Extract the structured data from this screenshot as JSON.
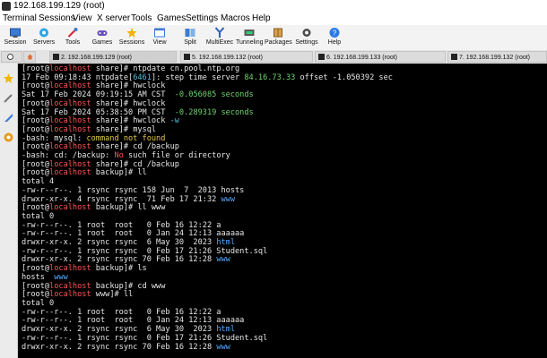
{
  "window": {
    "title": "192.168.199.129 (root)"
  },
  "menu": [
    "Terminal",
    "Sessions",
    "View",
    "X server",
    "Tools",
    "Games",
    "Settings",
    "Macros",
    "Help"
  ],
  "toolbar": [
    {
      "label": "Session",
      "icon": "session-icon"
    },
    {
      "label": "Servers",
      "icon": "servers-icon"
    },
    {
      "label": "Tools",
      "icon": "tools-icon"
    },
    {
      "label": "Games",
      "icon": "games-icon"
    },
    {
      "label": "Sessions",
      "icon": "sessions-icon"
    },
    {
      "label": "View",
      "icon": "view-icon"
    },
    {
      "label": "Split",
      "icon": "split-icon"
    },
    {
      "label": "MultiExec",
      "icon": "multiexec-icon"
    },
    {
      "label": "Tunneling",
      "icon": "tunneling-icon"
    },
    {
      "label": "Packages",
      "icon": "packages-icon"
    },
    {
      "label": "Settings",
      "icon": "settings-icon"
    },
    {
      "label": "Help",
      "icon": "help-icon"
    }
  ],
  "tabs": [
    {
      "label": "2. 192.168.199.129 (root)",
      "active": true
    },
    {
      "label": "5. 192.168.199.132 (root)",
      "active": false
    },
    {
      "label": "6. 192.168.199.133 (root)",
      "active": false
    },
    {
      "label": "7. 192.168.199.132 (root)",
      "active": false
    }
  ],
  "colors": {
    "red": "#ff5555",
    "cyan": "#55b9d8",
    "green": "#6fd36f",
    "yellow": "#e3c84a",
    "blue": "#55aaff"
  },
  "terminal": {
    "lines": [
      [
        {
          "t": "[root@"
        },
        {
          "t": "localhost",
          "c": "red"
        },
        {
          "t": " share]# ntpdate cn.pool.ntp.org"
        }
      ],
      [
        {
          "t": "17 Feb 09:18:43 ntpdate["
        },
        {
          "t": "6461",
          "c": "cy"
        },
        {
          "t": "]: step time server "
        },
        {
          "t": "84.16.73.33",
          "c": "gr"
        },
        {
          "t": " offset -1.050392 sec"
        }
      ],
      [
        {
          "t": "[root@"
        },
        {
          "t": "localhost",
          "c": "red"
        },
        {
          "t": " share]# hwclock"
        }
      ],
      [
        {
          "t": "Sat 17 Feb 2024 09:19:15 AM CST  "
        },
        {
          "t": "-0.056085 seconds",
          "c": "gr"
        }
      ],
      [
        {
          "t": "[root@"
        },
        {
          "t": "localhost",
          "c": "red"
        },
        {
          "t": " share]# hwclock"
        }
      ],
      [
        {
          "t": "Sat 17 Feb 2024 05:38:50 PM CST  "
        },
        {
          "t": "-0.289319 seconds",
          "c": "gr"
        }
      ],
      [
        {
          "t": "[root@"
        },
        {
          "t": "localhost",
          "c": "red"
        },
        {
          "t": " share]# hwclock "
        },
        {
          "t": "-w",
          "c": "cy"
        }
      ],
      [
        {
          "t": "[root@"
        },
        {
          "t": "localhost",
          "c": "red"
        },
        {
          "t": " share]# mysql"
        }
      ],
      [
        {
          "t": "-bash: mysql: "
        },
        {
          "t": "command not found",
          "c": "ye"
        }
      ],
      [
        {
          "t": "[root@"
        },
        {
          "t": "localhost",
          "c": "red"
        },
        {
          "t": " share]# cd /backup"
        }
      ],
      [
        {
          "t": "-bash: cd: /backup: "
        },
        {
          "t": "No",
          "c": "red"
        },
        {
          "t": " such file or directory"
        }
      ],
      [
        {
          "t": "[root@"
        },
        {
          "t": "localhost",
          "c": "red"
        },
        {
          "t": " share]# cd /backup"
        }
      ],
      [
        {
          "t": "[root@"
        },
        {
          "t": "localhost",
          "c": "red"
        },
        {
          "t": " backup]# ll"
        }
      ],
      [
        {
          "t": "total 4"
        }
      ],
      [
        {
          "t": "-rw-r--r--. 1 rsync rsync 158 Jun  7  2013 hosts"
        }
      ],
      [
        {
          "t": "drwxr-xr-x. 4 rsync rsync  71 Feb 17 21:32 "
        },
        {
          "t": "www",
          "c": "bl"
        }
      ],
      [
        {
          "t": "[root@"
        },
        {
          "t": "localhost",
          "c": "red"
        },
        {
          "t": " backup]# ll www"
        }
      ],
      [
        {
          "t": "total 0"
        }
      ],
      [
        {
          "t": "-rw-r--r--. 1 root  root   0 Feb 16 12:22 a"
        }
      ],
      [
        {
          "t": "-rw-r--r--. 1 root  root   0 Jan 24 12:13 aaaaaa"
        }
      ],
      [
        {
          "t": "drwxr-xr-x. 2 rsync rsync  6 May 30  2023 "
        },
        {
          "t": "html",
          "c": "bl"
        }
      ],
      [
        {
          "t": "-rw-r--r--. 1 rsync rsync  0 Feb 17 21:26 Student.sql"
        }
      ],
      [
        {
          "t": "drwxr-xr-x. 2 rsync rsync 70 Feb 16 12:28 "
        },
        {
          "t": "www",
          "c": "bl"
        }
      ],
      [
        {
          "t": "[root@"
        },
        {
          "t": "localhost",
          "c": "red"
        },
        {
          "t": " backup]# ls"
        }
      ],
      [
        {
          "t": "hosts  "
        },
        {
          "t": "www",
          "c": "bl"
        }
      ],
      [
        {
          "t": "[root@"
        },
        {
          "t": "localhost",
          "c": "red"
        },
        {
          "t": " backup]# cd www"
        }
      ],
      [
        {
          "t": "[root@"
        },
        {
          "t": "localhost",
          "c": "red"
        },
        {
          "t": " www]# ll"
        }
      ],
      [
        {
          "t": "total 0"
        }
      ],
      [
        {
          "t": "-rw-r--r--. 1 root  root   0 Feb 16 12:22 a"
        }
      ],
      [
        {
          "t": "-rw-r--r--. 1 root  root   0 Jan 24 12:13 aaaaaa"
        }
      ],
      [
        {
          "t": "drwxr-xr-x. 2 rsync rsync  6 May 30  2023 "
        },
        {
          "t": "html",
          "c": "bl"
        }
      ],
      [
        {
          "t": "-rw-r--r--. 1 rsync rsync  0 Feb 17 21:26 Student.sql"
        }
      ],
      [
        {
          "t": "drwxr-xr-x. 2 rsync rsync 70 Feb 16 12:28 "
        },
        {
          "t": "www",
          "c": "bl"
        }
      ]
    ]
  }
}
